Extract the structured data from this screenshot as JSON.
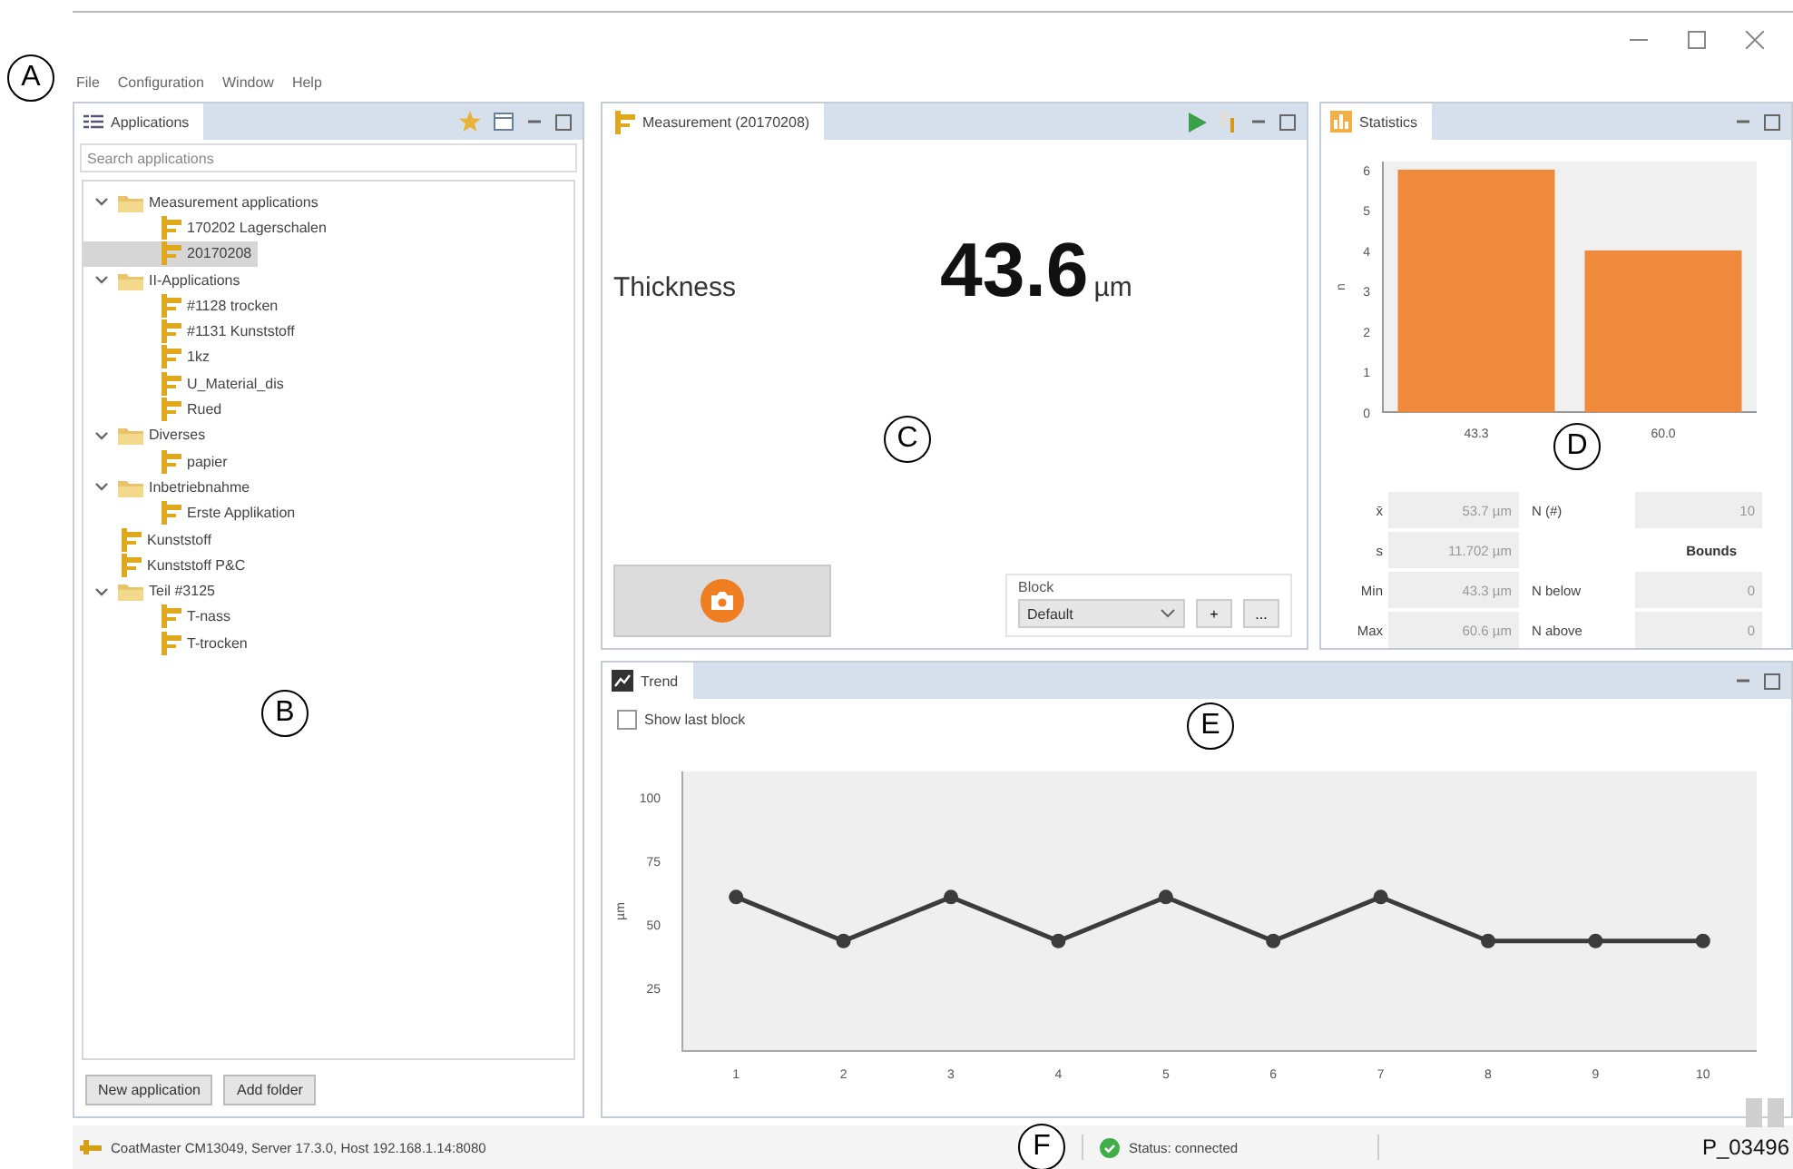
{
  "menu": {
    "callout": "A",
    "items": [
      "File",
      "Configuration",
      "Window",
      "Help"
    ]
  },
  "applications": {
    "title": "Applications",
    "callout": "B",
    "search": {
      "placeholder": "Search applications"
    },
    "tree": [
      {
        "label": "Measurement applications",
        "kind": "folder",
        "expanded": true,
        "selected": false,
        "children": [
          {
            "label": "170202 Lagerschalen",
            "kind": "app",
            "selected": false
          },
          {
            "label": "20170208",
            "kind": "app",
            "selected": true
          }
        ]
      },
      {
        "label": "II-Applications",
        "kind": "folder",
        "expanded": true,
        "selected": false,
        "children": [
          {
            "label": "#1128 trocken",
            "kind": "app",
            "selected": false
          },
          {
            "label": "#1131 Kunststoff",
            "kind": "app",
            "selected": false
          },
          {
            "label": "1kz",
            "kind": "app",
            "selected": false
          },
          {
            "label": "U_Material_dis",
            "kind": "app",
            "selected": false
          },
          {
            "label": "Rued",
            "kind": "app",
            "selected": false
          }
        ]
      },
      {
        "label": "Diverses",
        "kind": "folder",
        "expanded": true,
        "selected": false,
        "children": [
          {
            "label": "papier",
            "kind": "app",
            "selected": false
          }
        ]
      },
      {
        "label": "Inbetriebnahme",
        "kind": "folder",
        "expanded": true,
        "selected": false,
        "children": [
          {
            "label": "Erste Applikation",
            "kind": "app",
            "selected": false
          }
        ]
      },
      {
        "label": "Kunststoff",
        "kind": "app",
        "selected": false
      },
      {
        "label": "Kunststoff P&C",
        "kind": "app",
        "selected": false
      },
      {
        "label": "Teil #3125",
        "kind": "folder",
        "expanded": true,
        "selected": false,
        "children": [
          {
            "label": "T-nass",
            "kind": "app",
            "selected": false
          },
          {
            "label": "T-trocken",
            "kind": "app",
            "selected": false
          }
        ]
      }
    ],
    "buttons": [
      "New application",
      "Add folder"
    ]
  },
  "measurement": {
    "title": "Measurement (20170208)",
    "callout": "C",
    "quantity": "Thickness",
    "value": "43.6",
    "unit": "µm",
    "block": {
      "label": "Block",
      "value": "Default",
      "buttons": [
        "+",
        "..."
      ]
    }
  },
  "statistics": {
    "title": "Statistics",
    "callout": "D",
    "chart_data": {
      "type": "bar",
      "ylabel": "n",
      "categories": [
        "43.3",
        "60.0"
      ],
      "values": [
        6,
        4
      ],
      "ylim": [
        0,
        6.2
      ],
      "yticks": [
        0,
        1,
        2,
        3,
        4,
        5,
        6
      ]
    },
    "fields": [
      {
        "label": "x̄",
        "value": "53.7 µm"
      },
      {
        "label": "s",
        "value": "11.702 µm"
      },
      {
        "label": "Min",
        "value": "43.3 µm"
      },
      {
        "label": "Max",
        "value": "60.6 µm"
      }
    ],
    "n": {
      "label": "N (#)",
      "value": "10"
    },
    "bounds": {
      "title": "Bounds",
      "rows": [
        {
          "label": "N below",
          "value": "0"
        },
        {
          "label": "N above",
          "value": "0"
        }
      ]
    }
  },
  "trend": {
    "title": "Trend",
    "callout": "E",
    "show_last_block": {
      "label": "Show last block",
      "checked": false
    },
    "chart_data": {
      "type": "line",
      "ylabel": "µm",
      "x": [
        1,
        2,
        3,
        4,
        5,
        6,
        7,
        8,
        9,
        10
      ],
      "xlim": [
        0.5,
        10.5
      ],
      "series": [
        {
          "color": "#3c3c3c",
          "marker": "circle",
          "values": [
            60.6,
            43.3,
            60.6,
            43.3,
            60.6,
            43.3,
            60.6,
            43.3,
            43.3,
            43.3
          ]
        }
      ],
      "ylim": [
        0,
        110
      ],
      "yticks": [
        25,
        50,
        75,
        100
      ],
      "xticks": [
        1,
        2,
        3,
        4,
        5,
        6,
        7,
        8,
        9,
        10
      ]
    }
  },
  "status_bar": {
    "callout": "F",
    "connection": "CoatMaster CM13049, Server 17.3.0, Host 192.168.1.14:8080",
    "status": "Status: connected",
    "figure_id": "P_03496"
  }
}
